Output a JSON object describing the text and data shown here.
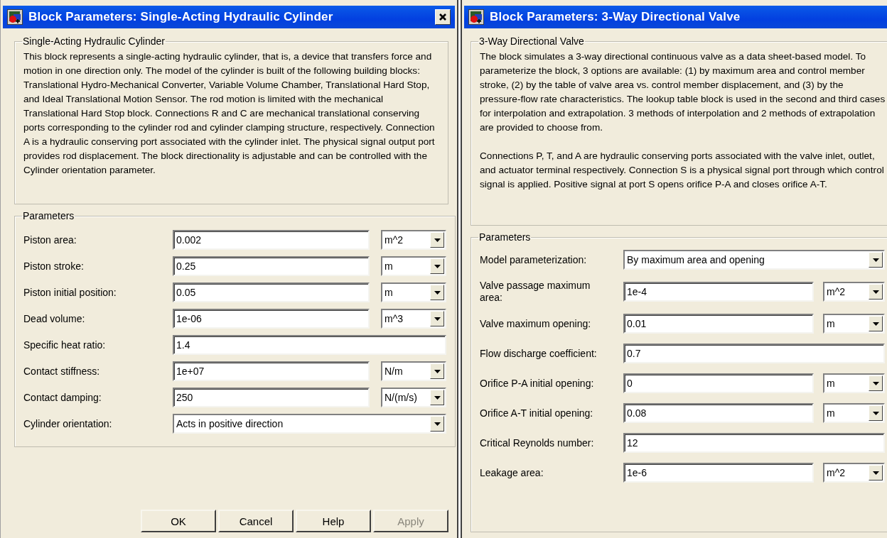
{
  "dialogs": [
    {
      "title": "Block Parameters: Single-Acting Hydraulic Cylinder",
      "close_button": true,
      "description": {
        "heading": "Single-Acting Hydraulic Cylinder",
        "paragraphs": [
          "This block represents a single-acting hydraulic cylinder, that is, a device that transfers force and motion in one direction only. The model of the cylinder is built of the following building blocks: Translational Hydro-Mechanical Converter, Variable Volume Chamber, Translational Hard Stop, and Ideal Translational Motion Sensor. The rod motion is limited with the mechanical Translational Hard Stop block. Connections R and C are mechanical translational conserving ports corresponding to the cylinder rod and cylinder clamping structure, respectively. Connection A is a hydraulic conserving port associated with the cylinder inlet. The physical signal output port provides rod displacement. The block directionality is adjustable and can be controlled with the Cylinder orientation parameter."
        ]
      },
      "parameters": {
        "heading": "Parameters",
        "rows": [
          {
            "kind": "unit",
            "label": "Piston area:",
            "value": "0.002",
            "unit": "m^2"
          },
          {
            "kind": "unit",
            "label": "Piston stroke:",
            "value": "0.25",
            "unit": "m"
          },
          {
            "kind": "unit",
            "label": "Piston initial position:",
            "value": "0.05",
            "unit": "m"
          },
          {
            "kind": "unit",
            "label": "Dead volume:",
            "value": "1e-06",
            "unit": "m^3"
          },
          {
            "kind": "text",
            "label": "Specific heat ratio:",
            "value": "1.4"
          },
          {
            "kind": "unit",
            "label": "Contact stiffness:",
            "value": "1e+07",
            "unit": "N/m"
          },
          {
            "kind": "unit",
            "label": "Contact damping:",
            "value": "250",
            "unit": "N/(m/s)"
          },
          {
            "kind": "select",
            "label": "Cylinder orientation:",
            "value": "Acts in positive direction"
          }
        ]
      },
      "buttons": [
        {
          "label": "OK",
          "disabled": false
        },
        {
          "label": "Cancel",
          "disabled": false
        },
        {
          "label": "Help",
          "disabled": false
        },
        {
          "label": "Apply",
          "disabled": true
        }
      ]
    },
    {
      "title": "Block Parameters: 3-Way Directional Valve",
      "close_button": false,
      "description": {
        "heading": "3-Way Directional Valve",
        "paragraphs": [
          "The block simulates a 3-way directional continuous valve as a data sheet-based model. To parameterize the block, 3 options are available: (1) by maximum area and control member stroke, (2) by the table of valve area vs. control member displacement, and (3) by the pressure-flow rate characteristics. The lookup table block is used in the second and third cases for interpolation and extrapolation. 3 methods of interpolation and 2 methods of extrapolation are provided to choose from.",
          "Connections P, T, and A are hydraulic conserving ports associated with the valve inlet, outlet, and actuator terminal respectively. Connection S is a physical signal port through which control signal is applied. Positive signal at port S opens orifice P-A and closes orifice A-T."
        ]
      },
      "parameters": {
        "heading": "Parameters",
        "rows": [
          {
            "kind": "select",
            "label": "Model parameterization:",
            "value": "By maximum area and opening"
          },
          {
            "kind": "unit",
            "label": "Valve passage maximum area:",
            "value": "1e-4",
            "unit": "m^2"
          },
          {
            "kind": "unit",
            "label": "Valve maximum opening:",
            "value": "0.01",
            "unit": "m"
          },
          {
            "kind": "text",
            "label": "Flow discharge coefficient:",
            "value": "0.7"
          },
          {
            "kind": "unit",
            "label": "Orifice P-A initial opening:",
            "value": "0",
            "unit": "m"
          },
          {
            "kind": "unit",
            "label": "Orifice A-T initial opening:",
            "value": "0.08",
            "unit": "m"
          },
          {
            "kind": "text",
            "label": "Critical Reynolds number:",
            "value": "12"
          },
          {
            "kind": "unit",
            "label": "Leakage area:",
            "value": "1e-6",
            "unit": "m^2"
          }
        ]
      }
    }
  ]
}
